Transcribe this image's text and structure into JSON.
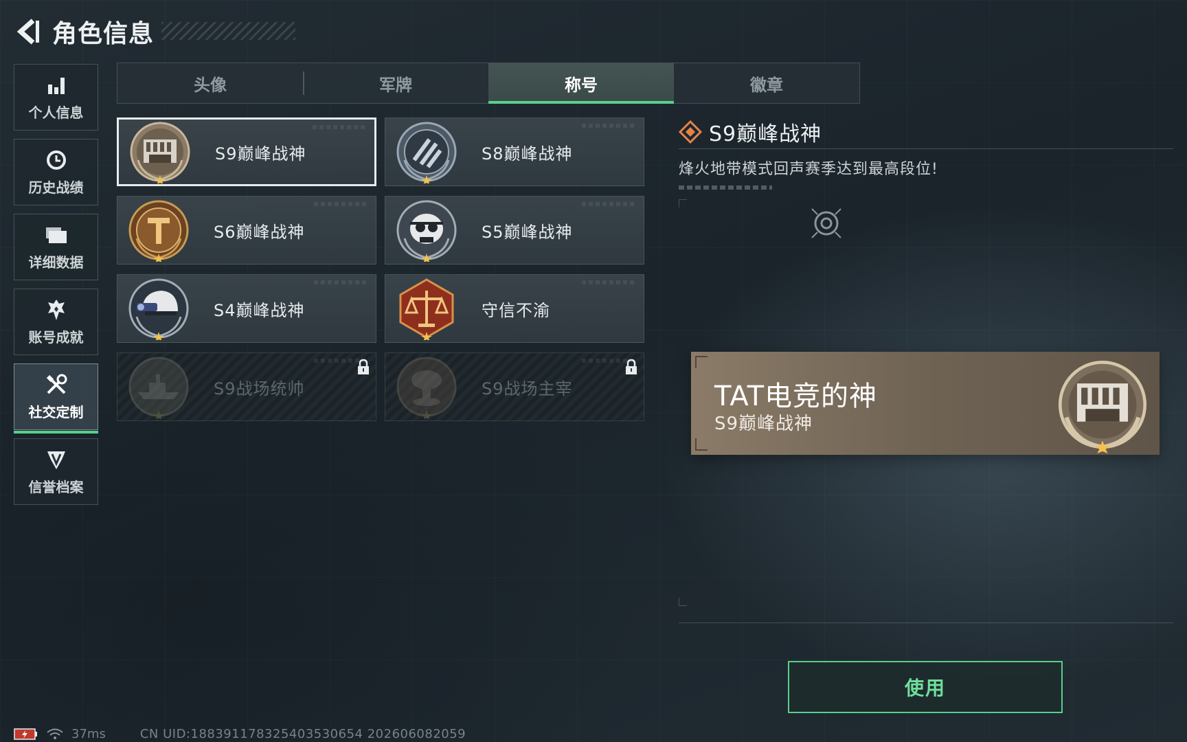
{
  "header": {
    "title": "角色信息"
  },
  "sidebar": {
    "items": [
      {
        "label": "个人信息",
        "icon": "bar-chart-icon",
        "active": false
      },
      {
        "label": "历史战绩",
        "icon": "history-clock-icon",
        "active": false
      },
      {
        "label": "详细数据",
        "icon": "folder-icon",
        "active": false
      },
      {
        "label": "账号成就",
        "icon": "achievement-icon",
        "active": false
      },
      {
        "label": "社交定制",
        "icon": "tools-icon",
        "active": true
      },
      {
        "label": "信誉档案",
        "icon": "credit-shield-icon",
        "active": false
      }
    ]
  },
  "tabs": [
    {
      "label": "头像",
      "active": false
    },
    {
      "label": "军牌",
      "active": false
    },
    {
      "label": "称号",
      "active": true
    },
    {
      "label": "徽章",
      "active": false
    }
  ],
  "titles": [
    {
      "name": "S9巅峰战神",
      "emblem": "fortress-emblem",
      "selected": true,
      "locked": false
    },
    {
      "name": "S8巅峰战神",
      "emblem": "slash-shield-emblem",
      "selected": false,
      "locked": false
    },
    {
      "name": "S6巅峰战神",
      "emblem": "t-shield-emblem",
      "selected": false,
      "locked": false
    },
    {
      "name": "S5巅峰战神",
      "emblem": "skull-emblem",
      "selected": false,
      "locked": false
    },
    {
      "name": "S4巅峰战神",
      "emblem": "helmet-emblem",
      "selected": false,
      "locked": false
    },
    {
      "name": "守信不渝",
      "emblem": "scales-emblem",
      "selected": false,
      "locked": false
    },
    {
      "name": "S9战场统帅",
      "emblem": "warship-emblem",
      "selected": false,
      "locked": true
    },
    {
      "name": "S9战场主宰",
      "emblem": "mushroom-cloud-emblem",
      "selected": false,
      "locked": true
    }
  ],
  "detail": {
    "title": "S9巅峰战神",
    "description": "烽火地带模式回声赛季达到最高段位!"
  },
  "preview": {
    "player_name": "TAT电竞的神",
    "title": "S9巅峰战神"
  },
  "actions": {
    "use_label": "使用"
  },
  "status_bar": {
    "ping": "37ms",
    "uid": "CN UID:188391178325403530654 202606082059"
  },
  "colors": {
    "accent_green": "#58d08c",
    "use_text": "#6fe09d",
    "bronze_emblem": "#8b7b68",
    "detail_diamond": "#e3834a"
  }
}
